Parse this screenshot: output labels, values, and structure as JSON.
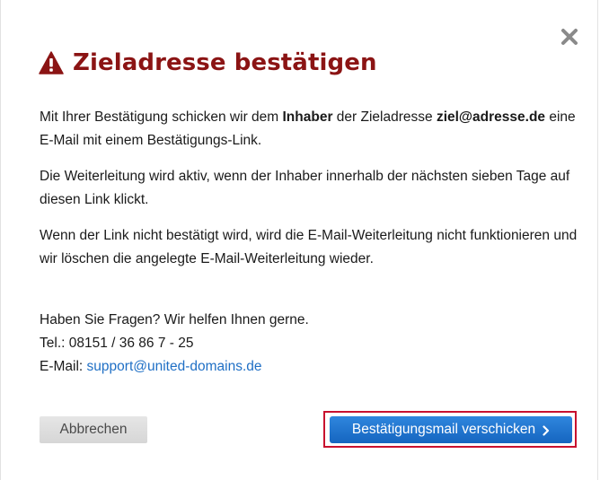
{
  "dialog": {
    "title": "Zieladresse bestätigen",
    "icons": {
      "close": "close-icon",
      "warning": "warning-triangle-icon",
      "send_chevron": "chevron-right-icon"
    },
    "paragraph1": {
      "part1": "Mit Ihrer Bestätigung schicken wir dem ",
      "bold1": "Inhaber",
      "part2": " der Zieladresse ",
      "bold2": "ziel@adresse.de",
      "part3": " eine E-Mail mit einem Bestätigungs-Link."
    },
    "paragraph2": "Die Weiterleitung wird aktiv, wenn der Inhaber innerhalb der nächsten sieben Tage auf diesen Link klickt.",
    "paragraph3": "Wenn der Link nicht bestätigt wird, wird die E-Mail-Weiterleitung nicht funktionieren und wir löschen die angelegte E-Mail-Weiterleitung wieder.",
    "contact": {
      "question": "Haben Sie Fragen? Wir helfen Ihnen gerne.",
      "phone": "Tel.: 08151 / 36 86 7 - 25",
      "email_label": "E-Mail: ",
      "email_link": "support@united-domains.de"
    },
    "buttons": {
      "cancel_label": "Abbrechen",
      "send_label": "Bestätigungsmail verschicken"
    },
    "colors": {
      "title": "#8b1414",
      "primary_button": "#1f6fc5",
      "highlight": "#c8102e",
      "link": "#1f6fc5"
    }
  }
}
